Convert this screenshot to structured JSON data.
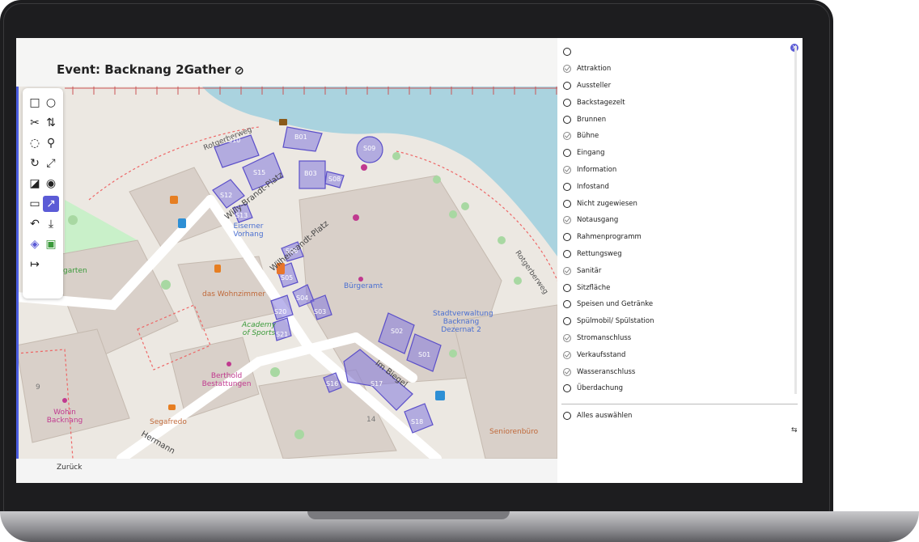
{
  "event_title": "Event: Backnang 2Gather",
  "back_label": "Zurück",
  "select_all_label": "Alles auswählen",
  "categories": [
    {
      "label": "",
      "checked": false
    },
    {
      "label": "Attraktion",
      "checked": true
    },
    {
      "label": "Aussteller",
      "checked": false
    },
    {
      "label": "Backstagezelt",
      "checked": false
    },
    {
      "label": "Brunnen",
      "checked": false
    },
    {
      "label": "Bühne",
      "checked": true
    },
    {
      "label": "Eingang",
      "checked": false
    },
    {
      "label": "Information",
      "checked": true
    },
    {
      "label": "Infostand",
      "checked": false
    },
    {
      "label": "Nicht zugewiesen",
      "checked": false
    },
    {
      "label": "Notausgang",
      "checked": true
    },
    {
      "label": "Rahmenprogramm",
      "checked": false
    },
    {
      "label": "Rettungsweg",
      "checked": false
    },
    {
      "label": "Sanitär",
      "checked": true
    },
    {
      "label": "Sitzfläche",
      "checked": false
    },
    {
      "label": "Speisen und Getränke",
      "checked": false
    },
    {
      "label": "Spülmobil/ Spülstation",
      "checked": false
    },
    {
      "label": "Stromanschluss",
      "checked": true
    },
    {
      "label": "Verkaufsstand",
      "checked": true
    },
    {
      "label": "Wasseranschluss",
      "checked": true
    },
    {
      "label": "Überdachung",
      "checked": false
    }
  ],
  "map_labels": {
    "street1": "Rotgerberweg",
    "street2": "Willy-Brandt-Platz",
    "street3": "Wilhelmandt-Platz",
    "street4": "Rotgerberweg",
    "street5": "Im Biegel",
    "street6": "Hermann",
    "poi1": "Eiserner Vorhang",
    "poi2": "Bürgeramt",
    "poi3": "Stadtverwaltung Backnang Dezernat 2",
    "poi4": "das Wohnzimmer",
    "poi5": "Academy of Sports",
    "poi6": "Berthold Bestattungen",
    "poi7": "Segafredo",
    "poi8": "Wohin Backnang",
    "poi9": "Seniorenbüro",
    "poi10": "garten",
    "num14": "14",
    "num9": "9"
  },
  "stands": [
    "S10",
    "B01",
    "S09",
    "S15",
    "B03",
    "S08",
    "S12",
    "S13",
    "S06",
    "S05",
    "S04",
    "S03",
    "S20",
    "S21",
    "S02",
    "S01",
    "S16",
    "S17",
    "S18"
  ],
  "tools": [
    "square-icon",
    "circle-icon",
    "scissors-icon",
    "split-icon",
    "lasso-icon",
    "pin-icon",
    "rotate-icon",
    "resize-icon",
    "layers-fill-icon",
    "eye-icon",
    "ruler-icon",
    "chart-line-icon",
    "undo-icon",
    "download-icon",
    "layers-icon",
    "export-icon",
    "logout-icon"
  ]
}
